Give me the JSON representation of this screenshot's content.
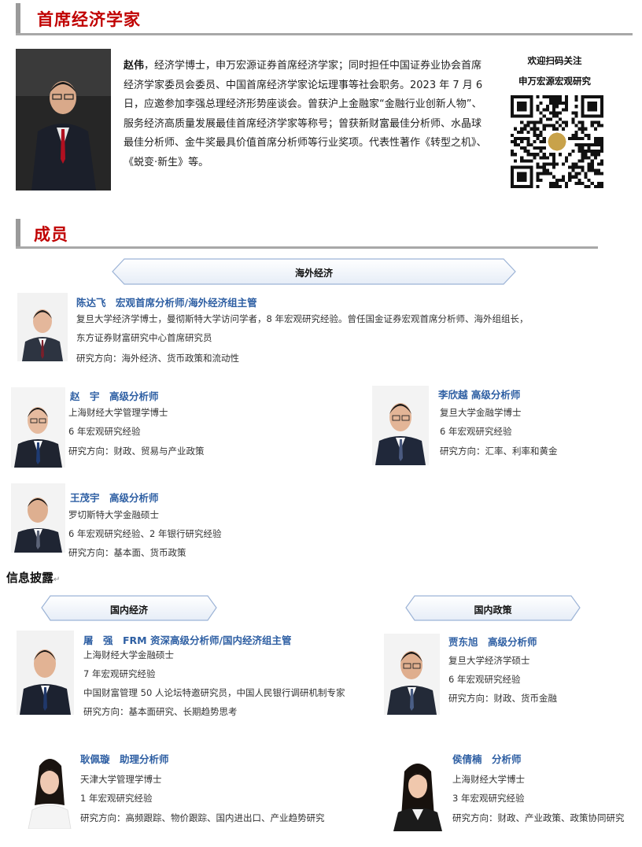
{
  "chief": {
    "section_title": "首席经济学家",
    "bio_name": "赵伟",
    "bio_text": "，经济学博士，申万宏源证券首席经济学家；同时担任中国证券业协会首席经济学家委员会委员、中国首席经济学家论坛理事等社会职务。2023 年 7 月 6 日，应邀参加李强总理经济形势座谈会。曾获沪上金融家“金融行业创新人物”、服务经济高质量发展最佳首席经济学家等称号；曾获新财富最佳分析师、水晶球最佳分析师、金牛奖最具价值首席分析师等行业奖项。代表性著作《转型之机》、《蜕变·新生》等。",
    "qr_line1": "欢迎扫码关注",
    "qr_line2": "申万宏源宏观研究"
  },
  "members": {
    "section_title": "成员",
    "overseas_banner": "海外经济",
    "domestic_banner": "国内经济",
    "policy_banner": "国内政策",
    "disclosure": "信息披露",
    "disclosure_mark": "↵",
    "chen": {
      "name": "陈达飞　宏观首席分析师/海外经济组主管",
      "line1": "复旦大学经济学博士，曼彻斯特大学访问学者，8 年宏观研究经验。曾任国金证券宏观首席分析师、海外组组长，",
      "line2": "东方证券财富研究中心首席研究员",
      "line3": "研究方向：海外经济、货币政策和流动性"
    },
    "zhaoyu": {
      "name": "赵　宇　高级分析师",
      "line1": "上海财经大学管理学博士",
      "line2": "6 年宏观研究经验",
      "line3": "研究方向：财政、贸易与产业政策"
    },
    "li": {
      "name": "李欣越  高级分析师",
      "line1": "复旦大学金融学博士",
      "line2": "6 年宏观研究经验",
      "line3": "研究方向：汇率、利率和黄金"
    },
    "wang": {
      "name": "王茂宇　高级分析师",
      "line1": "罗切斯特大学金融硕士",
      "line2": "6 年宏观研究经验、2 年银行研究经验",
      "line3": "研究方向：基本面、货币政策"
    },
    "tu": {
      "name": "屠　强　FRM  资深高级分析师/国内经济组主管",
      "line1": "上海财经大学金融硕士",
      "line2": "7 年宏观研究经验",
      "line3": "中国财富管理 50 人论坛特邀研究员，中国人民银行调研机制专家",
      "line4": "研究方向：基本面研究、长期趋势思考"
    },
    "jia": {
      "name": "贾东旭　高级分析师",
      "line1": "复旦大学经济学硕士",
      "line2": "6 年宏观研究经验",
      "line3": "研究方向：财政、货币金融"
    },
    "geng": {
      "name": "耿佩璇　助理分析师",
      "line1": "天津大学管理学博士",
      "line2": "1 年宏观研究经验",
      "line3": "研究方向：高频跟踪、物价跟踪、国内进出口、产业趋势研究"
    },
    "hou": {
      "name": "侯倩楠　分析师",
      "line1": "上海财经大学博士",
      "line2": "3 年宏观研究经验",
      "line3": "研究方向：财政、产业政策、政策协同研究"
    }
  },
  "colors": {
    "section_red": "#c00000",
    "member_blue": "#2e5fa3",
    "banner_border": "#9cb3d6"
  }
}
